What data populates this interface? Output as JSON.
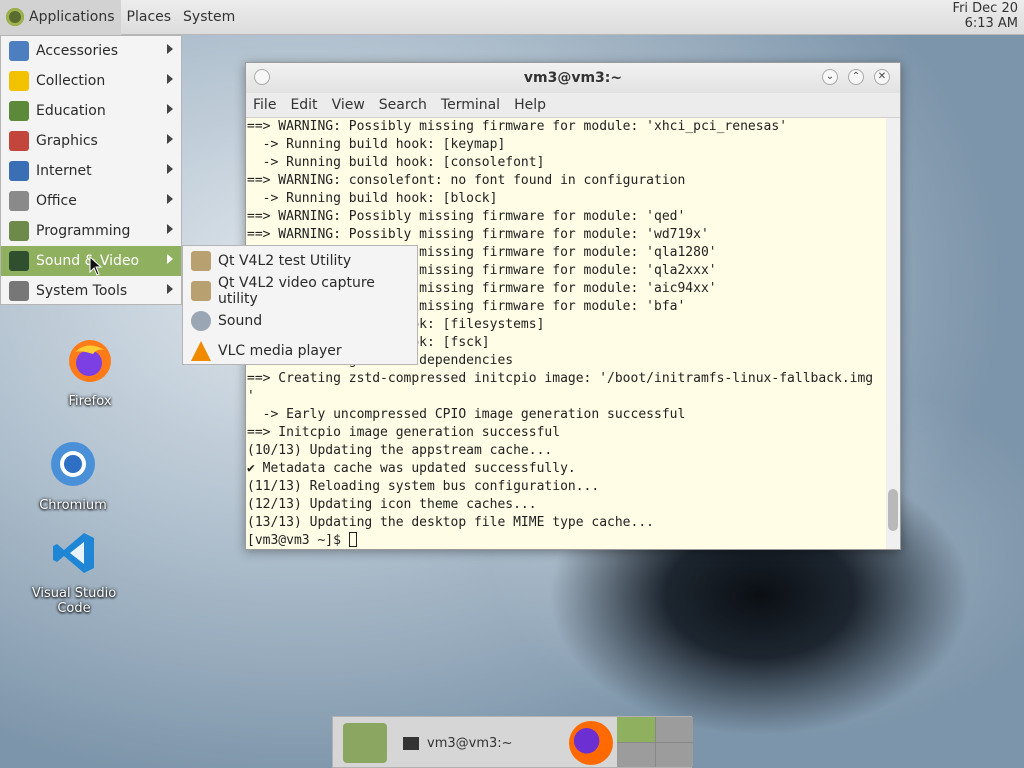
{
  "top_panel": {
    "menus": [
      "Applications",
      "Places",
      "System"
    ],
    "clock": {
      "date": "Fri Dec 20",
      "time": "6:13 AM"
    }
  },
  "app_menu": {
    "items": [
      {
        "label": "Accessories",
        "icon": "accessories-icon",
        "color": "#4d7fc0"
      },
      {
        "label": "Collection",
        "icon": "star-icon",
        "color": "#f2c200"
      },
      {
        "label": "Education",
        "icon": "education-icon",
        "color": "#5c8a3a"
      },
      {
        "label": "Graphics",
        "icon": "graphics-icon",
        "color": "#c2463b"
      },
      {
        "label": "Internet",
        "icon": "globe-icon",
        "color": "#3b6fb5"
      },
      {
        "label": "Office",
        "icon": "office-icon",
        "color": "#8a8a8a"
      },
      {
        "label": "Programming",
        "icon": "programming-icon",
        "color": "#6d8a4a"
      },
      {
        "label": "Sound & Video",
        "icon": "sound-video-icon",
        "color": "#2f4f2f"
      },
      {
        "label": "System Tools",
        "icon": "system-tools-icon",
        "color": "#777777"
      }
    ],
    "active_index": 7
  },
  "submenu": {
    "items": [
      {
        "label": "Qt V4L2 test Utility",
        "icon": "qt-v4l2-icon"
      },
      {
        "label": "Qt V4L2 video capture utility",
        "icon": "qt-v4l2-capture-icon"
      },
      {
        "label": "Sound",
        "icon": "sound-icon"
      },
      {
        "label": "VLC media player",
        "icon": "vlc-icon"
      }
    ]
  },
  "desktop_icons": [
    {
      "label": "Firefox",
      "icon": "firefox-icon"
    },
    {
      "label": "Chromium",
      "icon": "chromium-icon"
    },
    {
      "label": "Visual Studio Code",
      "icon": "vscode-icon"
    }
  ],
  "terminal": {
    "title": "vm3@vm3:~",
    "menu": [
      "File",
      "Edit",
      "View",
      "Search",
      "Terminal",
      "Help"
    ],
    "lines": [
      "==> WARNING: Possibly missing firmware for module: 'xhci_pci_renesas'",
      "  -> Running build hook: [keymap]",
      "  -> Running build hook: [consolefont]",
      "==> WARNING: consolefont: no font found in configuration",
      "  -> Running build hook: [block]",
      "==> WARNING: Possibly missing firmware for module: 'qed'",
      "==> WARNING: Possibly missing firmware for module: 'wd719x'",
      "==> WARNING: Possibly missing firmware for module: 'qla1280'",
      "==> WARNING: Possibly missing firmware for module: 'qla2xxx'",
      "==> WARNING: Possibly missing firmware for module: 'aic94xx'",
      "==> WARNING: Possibly missing firmware for module: 'bfa'",
      "  -> Running build hook: [filesystems]",
      "  -> Running build hook: [fsck]",
      "==> Generating module dependencies",
      "==> Creating zstd-compressed initcpio image: '/boot/initramfs-linux-fallback.img",
      "'",
      "  -> Early uncompressed CPIO image generation successful",
      "==> Initcpio image generation successful",
      "(10/13) Updating the appstream cache...",
      "✔ Metadata cache was updated successfully.",
      "(11/13) Reloading system bus configuration...",
      "(12/13) Updating icon theme caches...",
      "(13/13) Updating the desktop file MIME type cache..."
    ],
    "prompt": "[vm3@vm3 ~]$ "
  },
  "taskbar": {
    "window_label": "vm3@vm3:~"
  }
}
